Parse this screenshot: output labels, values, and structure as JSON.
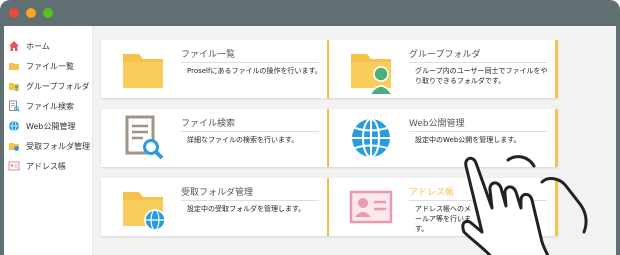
{
  "window": {
    "controls": [
      "close",
      "minimize",
      "maximize"
    ],
    "colors": {
      "titlebar": "#5f6f72",
      "accent": "#f5c24a",
      "folder": "#f5c24a",
      "globe": "#2b9be0"
    }
  },
  "sidebar": {
    "items": [
      {
        "label": "ホーム",
        "icon": "home-icon"
      },
      {
        "label": "ファイル一覧",
        "icon": "folder-icon"
      },
      {
        "label": "グループフォルダ",
        "icon": "group-folder-icon"
      },
      {
        "label": "ファイル検索",
        "icon": "file-search-icon"
      },
      {
        "label": "Web公開管理",
        "icon": "globe-icon"
      },
      {
        "label": "受取フォルダ管理",
        "icon": "receive-folder-icon"
      },
      {
        "label": "アドレス帳",
        "icon": "address-book-icon"
      }
    ]
  },
  "cards": [
    {
      "title": "ファイル一覧",
      "desc": "Proselfにあるファイルの操作を行います。",
      "icon": "folder-icon"
    },
    {
      "title": "グループフォルダ",
      "desc": "グループ内のユーザー同士でファイルをやり取りできるフォルダです。",
      "icon": "group-folder-icon"
    },
    {
      "title": "ファイル検索",
      "desc": "詳細なファイルの検索を行います。",
      "icon": "file-search-icon"
    },
    {
      "title": "Web公開管理",
      "desc": "設定中のWeb公開を管理します。",
      "icon": "globe-icon"
    },
    {
      "title": "受取フォルダ管理",
      "desc": "設定中の受取フォルダを管理します。",
      "icon": "receive-folder-icon"
    },
    {
      "title": "アドレス帳",
      "desc": "アドレス帳へのメールア等を行います。",
      "icon": "address-book-icon"
    }
  ]
}
